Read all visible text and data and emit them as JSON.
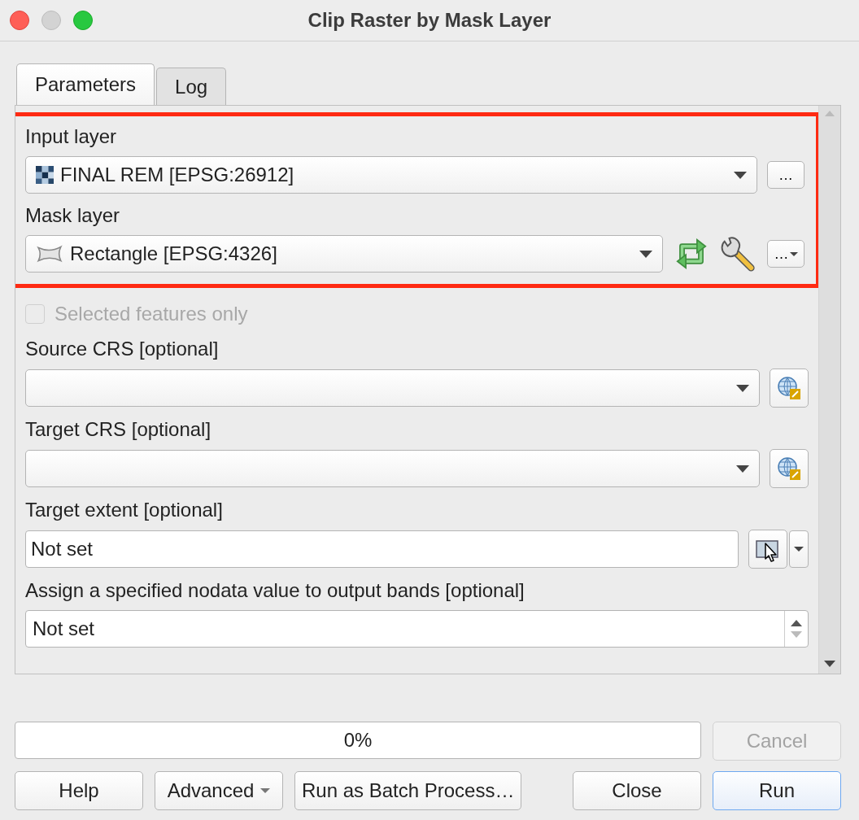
{
  "window": {
    "title": "Clip Raster by Mask Layer"
  },
  "tabs": [
    {
      "label": "Parameters",
      "selected": true
    },
    {
      "label": "Log",
      "selected": false
    }
  ],
  "highlighted_parameters": [
    {
      "kind": "raster-layer",
      "label": "Input layer",
      "value": "FINAL REM [EPSG:26912]",
      "button": "…"
    },
    {
      "kind": "vector-layer",
      "label": "Mask layer",
      "value": "Rectangle [EPSG:4326]",
      "button": "…"
    }
  ],
  "parameters": [
    {
      "kind": "checkbox",
      "label": "Selected features only",
      "checked": false,
      "disabled": true
    },
    {
      "kind": "crs",
      "label": "Source CRS [optional]"
    },
    {
      "kind": "crs",
      "label": "Target CRS [optional]"
    },
    {
      "kind": "extent",
      "label": "Target extent [optional]",
      "value": "Not set"
    },
    {
      "kind": "number",
      "label": "Assign a specified nodata value to output bands [optional]",
      "value": "Not set"
    }
  ],
  "progress": {
    "level": 0,
    "text": "0%"
  },
  "cancel_button": {
    "label": "Cancel",
    "disabled": true
  },
  "buttons": [
    {
      "kind": "plain",
      "label": "Help"
    },
    {
      "kind": "menu",
      "label": "Advanced"
    },
    {
      "kind": "plain",
      "label": "Run as Batch Process…"
    },
    {
      "kind": "spacer"
    },
    {
      "kind": "plain",
      "label": "Close"
    },
    {
      "kind": "default",
      "label": "Run"
    }
  ]
}
